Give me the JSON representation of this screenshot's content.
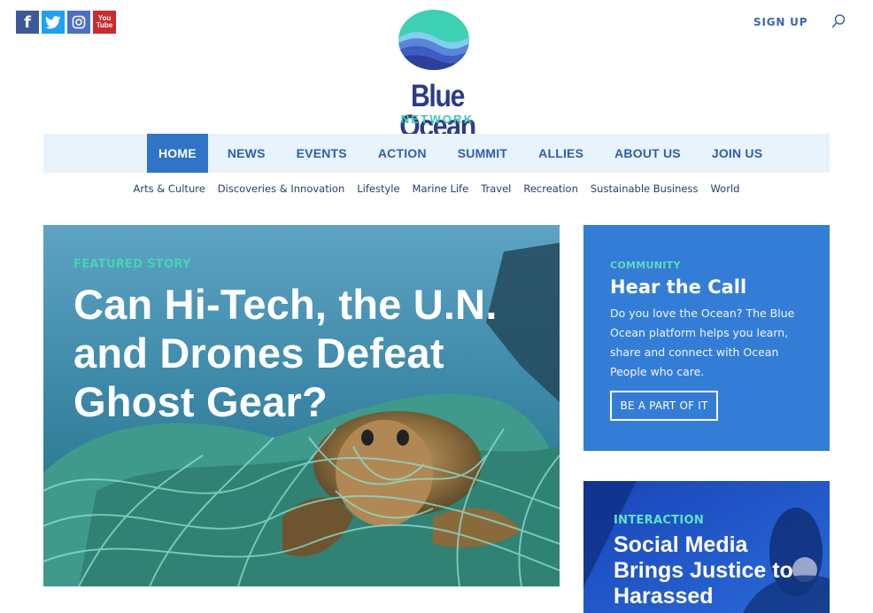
{
  "social": {
    "facebook": {
      "glyph": "f",
      "icon": "facebook-icon",
      "color": "#3b5998"
    },
    "twitter": {
      "icon": "twitter-icon",
      "color": "#1da1f2"
    },
    "instagram": {
      "icon": "instagram-icon",
      "color": "#4b6fc8"
    },
    "youtube": {
      "line1": "You",
      "line2": "Tube",
      "icon": "youtube-icon",
      "color": "#cc2b2b"
    }
  },
  "header": {
    "signup_label": "SIGN UP",
    "search_icon": "search-icon"
  },
  "logo": {
    "title": "Blue Ocean",
    "subtitle": "NETWORK",
    "colors": {
      "teal": "#3ac9b1",
      "navy": "#2b3c8c",
      "blue": "#3f65c0"
    }
  },
  "nav": {
    "items": [
      {
        "label": "HOME",
        "active": true
      },
      {
        "label": "NEWS"
      },
      {
        "label": "EVENTS"
      },
      {
        "label": "ACTION"
      },
      {
        "label": "SUMMIT"
      },
      {
        "label": "ALLIES"
      },
      {
        "label": "ABOUT US"
      },
      {
        "label": "JOIN US"
      }
    ],
    "active_color": "#2f74c6",
    "bg_color": "#e9f3fc"
  },
  "subnav": {
    "items": [
      "Arts & Culture",
      "Discoveries & Innovation",
      "Lifestyle",
      "Marine Life",
      "Travel",
      "Recreation",
      "Sustainable Business",
      "World"
    ]
  },
  "featured": {
    "kicker": "FEATURED STORY",
    "title": "Can Hi-Tech, the U.N. and Drones Defeat Ghost Gear?",
    "kicker_color": "#47d3b4"
  },
  "community": {
    "kicker": "COMMUNITY",
    "title": "Hear the Call",
    "text": "Do you love the Ocean? The Blue Ocean platform helps you learn, share and connect with Ocean People who care.",
    "button_label": "BE A PART OF IT",
    "bg_color": "#347dd6"
  },
  "interaction": {
    "kicker": "INTERACTION",
    "title": "Social Media Brings Justice to Harassed"
  }
}
